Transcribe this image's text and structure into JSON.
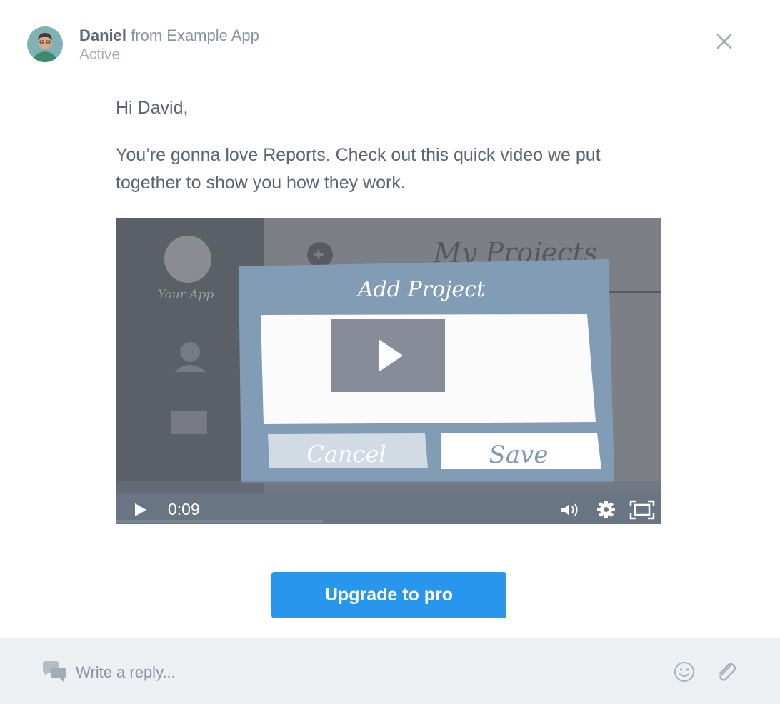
{
  "header": {
    "sender_name": "Daniel",
    "sender_from": "from Example App",
    "status": "Active"
  },
  "message": {
    "greeting": "Hi David,",
    "body": "You’re gonna love Reports. Check out this quick video we put together to show you how they work."
  },
  "video": {
    "time": "0:09",
    "thumbnail": {
      "app_label": "Your App",
      "page_title": "My Projects",
      "dialog_title": "Add Project",
      "cancel_label": "Cancel",
      "save_label": "Save"
    }
  },
  "cta": {
    "label": "Upgrade to pro"
  },
  "reply": {
    "placeholder": "Write a reply..."
  },
  "colors": {
    "accent": "#2996ee",
    "text": "#5c6573",
    "muted": "#a5acb7",
    "footer_bg": "#edf0f3"
  },
  "icons": [
    "avatar",
    "close-icon",
    "play-icon",
    "volume-icon",
    "gear-icon",
    "fullscreen-icon",
    "chat-icon",
    "emoji-icon",
    "paperclip-icon"
  ]
}
